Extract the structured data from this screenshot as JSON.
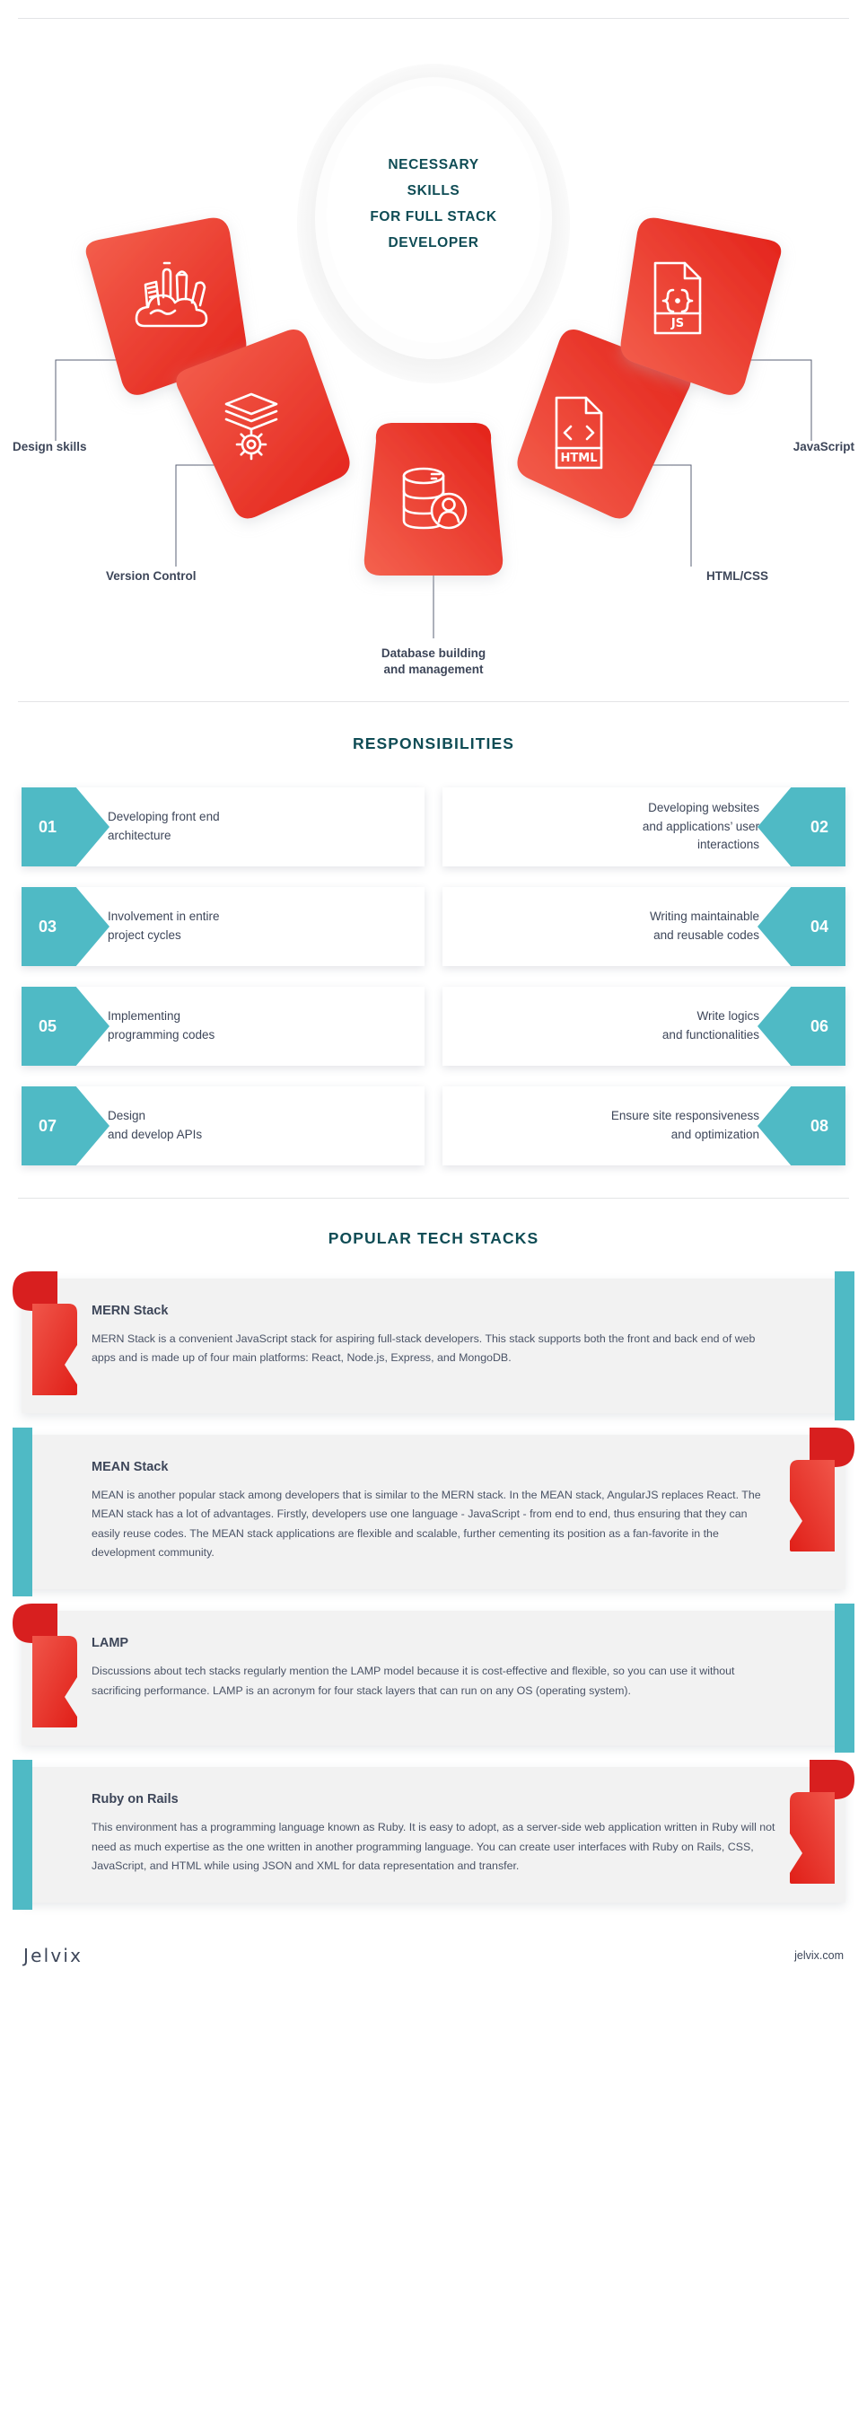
{
  "colors": {
    "red_light": "#f15a4a",
    "red_dark": "#e02020",
    "teal": "#4fbac5",
    "heading_dark_teal": "#0f4c55",
    "body_text": "#3d4659",
    "card_bg": "#f2f2f2"
  },
  "skills": {
    "center_title_lines": [
      "NECESSARY",
      "SKILLS",
      "FOR FULL STACK",
      "DEVELOPER"
    ],
    "center_title": "NECESSARY SKILLS FOR FULL STACK DEVELOPER",
    "petals": [
      {
        "label": "Design skills",
        "icon": "design-tools-icon",
        "position": "far-left"
      },
      {
        "label": "Version Control",
        "icon": "layers-gear-icon",
        "position": "left"
      },
      {
        "label": "Database building\nand management",
        "icon": "database-user-icon",
        "position": "center"
      },
      {
        "label": "HTML/CSS",
        "icon": "html-file-icon",
        "position": "right"
      },
      {
        "label": "JavaScript",
        "icon": "js-file-icon",
        "position": "far-right"
      }
    ]
  },
  "responsibilities": {
    "heading": "RESPONSIBILITIES",
    "items": [
      {
        "number": "01",
        "text": "Developing front end\narchitecture",
        "side": "left"
      },
      {
        "number": "02",
        "text": "Developing websites\nand applications’ user\ninteractions",
        "side": "right"
      },
      {
        "number": "03",
        "text": "Involvement in entire\nproject cycles",
        "side": "left"
      },
      {
        "number": "04",
        "text": "Writing maintainable\nand reusable codes",
        "side": "right"
      },
      {
        "number": "05",
        "text": "Implementing\nprogramming codes",
        "side": "left"
      },
      {
        "number": "06",
        "text": "Write logics\nand functionalities",
        "side": "right"
      },
      {
        "number": "07",
        "text": "Design\nand develop APIs",
        "side": "left"
      },
      {
        "number": "08",
        "text": "Ensure site responsiveness\nand optimization",
        "side": "right"
      }
    ]
  },
  "tech_stacks": {
    "heading": "POPULAR TECH STACKS",
    "items": [
      {
        "title": "MERN Stack",
        "description": "MERN Stack is a convenient JavaScript stack for aspiring full-stack developers. This stack supports both the front and back end of web apps and is made up of four main platforms: React, Node.js, Express, and MongoDB.",
        "ribbon_side": "left",
        "strip_side": "right"
      },
      {
        "title": "MEAN Stack",
        "description": "MEAN is another popular stack among developers that is similar to the MERN stack. In the MEAN stack, AngularJS replaces React. The MEAN stack has a lot of advantages. Firstly, developers use one language - JavaScript - from end to end, thus ensuring that they can easily reuse codes. The MEAN stack applications are flexible and scalable, further cementing its position as a fan-favorite in the development community.",
        "ribbon_side": "right",
        "strip_side": "left"
      },
      {
        "title": "LAMP",
        "description": "Discussions about tech stacks regularly mention the LAMP model because it is cost-effective and flexible, so you can use it without sacrificing performance. LAMP is an acronym for four stack layers that can run on any OS (operating system).",
        "ribbon_side": "left",
        "strip_side": "right"
      },
      {
        "title": "Ruby on Rails",
        "description": "This environment has a programming language known as Ruby. It is easy to adopt, as a server-side web application written in Ruby will not need as much expertise as the one written in another programming language. You can create user interfaces with Ruby on Rails, CSS, JavaScript, and HTML while using JSON and XML for data representation and transfer.",
        "ribbon_side": "right",
        "strip_side": "left"
      }
    ]
  },
  "footer": {
    "logo": "Jelvix",
    "website": "jelvix.com"
  }
}
